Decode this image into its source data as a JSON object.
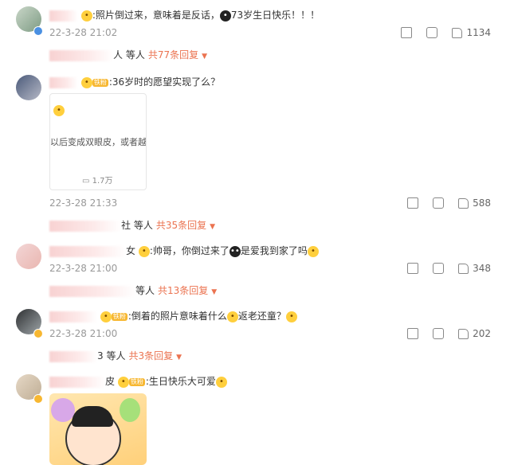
{
  "comments": [
    {
      "text": ":照片倒过来，意味着是反话，",
      "text_after": "73岁生日快乐！！！",
      "time": "22-3-28 21:02",
      "likes": "1134",
      "replies": {
        "suffix": "人 等人",
        "count": "共77条回复"
      }
    },
    {
      "fan_badge": "铁粉",
      "text": ":36岁时的愿望实现了么？",
      "card": {
        "text": "以后变成双眼皮，或者越",
        "footer": "1.7万"
      },
      "time": "22-3-28 21:33",
      "likes": "588",
      "replies": {
        "suffix": "社 等人",
        "count": "共35条回复"
      }
    },
    {
      "name_tail": "女",
      "text": ":帅哥，你倒过来了",
      "text_after": "是爱我到家了吗",
      "time": "22-3-28 21:00",
      "likes": "348",
      "replies": {
        "suffix": "等人",
        "count": "共13条回复"
      }
    },
    {
      "fan_badge": "铁粉",
      "text": ":倒着的照片意味着什么",
      "text_after": "返老还童？",
      "time": "22-3-28 21:00",
      "likes": "202",
      "replies": {
        "suffix": "3 等人",
        "count": "共3条回复"
      }
    },
    {
      "name_tail": "皮",
      "fan_badge": "铁粉",
      "text": ":生日快乐大可爱"
    }
  ],
  "icons": [
    "share-icon",
    "comment-icon",
    "like-icon",
    "verified-icon",
    "emoji-icon",
    "chevron-down-icon"
  ],
  "colors": {
    "accent": "#eb7350",
    "meta": "#999999",
    "badge": "#f7b731"
  }
}
